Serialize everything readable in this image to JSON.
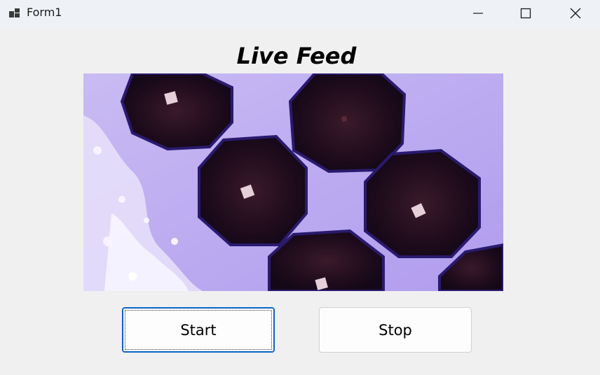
{
  "window": {
    "title": "Form1"
  },
  "caption_buttons": {
    "minimize_icon": "minimize-icon",
    "maximize_icon": "maximize-icon",
    "close_icon": "close-icon"
  },
  "main": {
    "heading": "Live Feed",
    "feed_image": "live camera feed of purple octagonal wells",
    "start_label": "Start",
    "stop_label": "Stop"
  },
  "colors": {
    "titlebar_bg": "#eef1f6",
    "window_bg": "#f0f0f0",
    "focus_border": "#0a64c8"
  }
}
